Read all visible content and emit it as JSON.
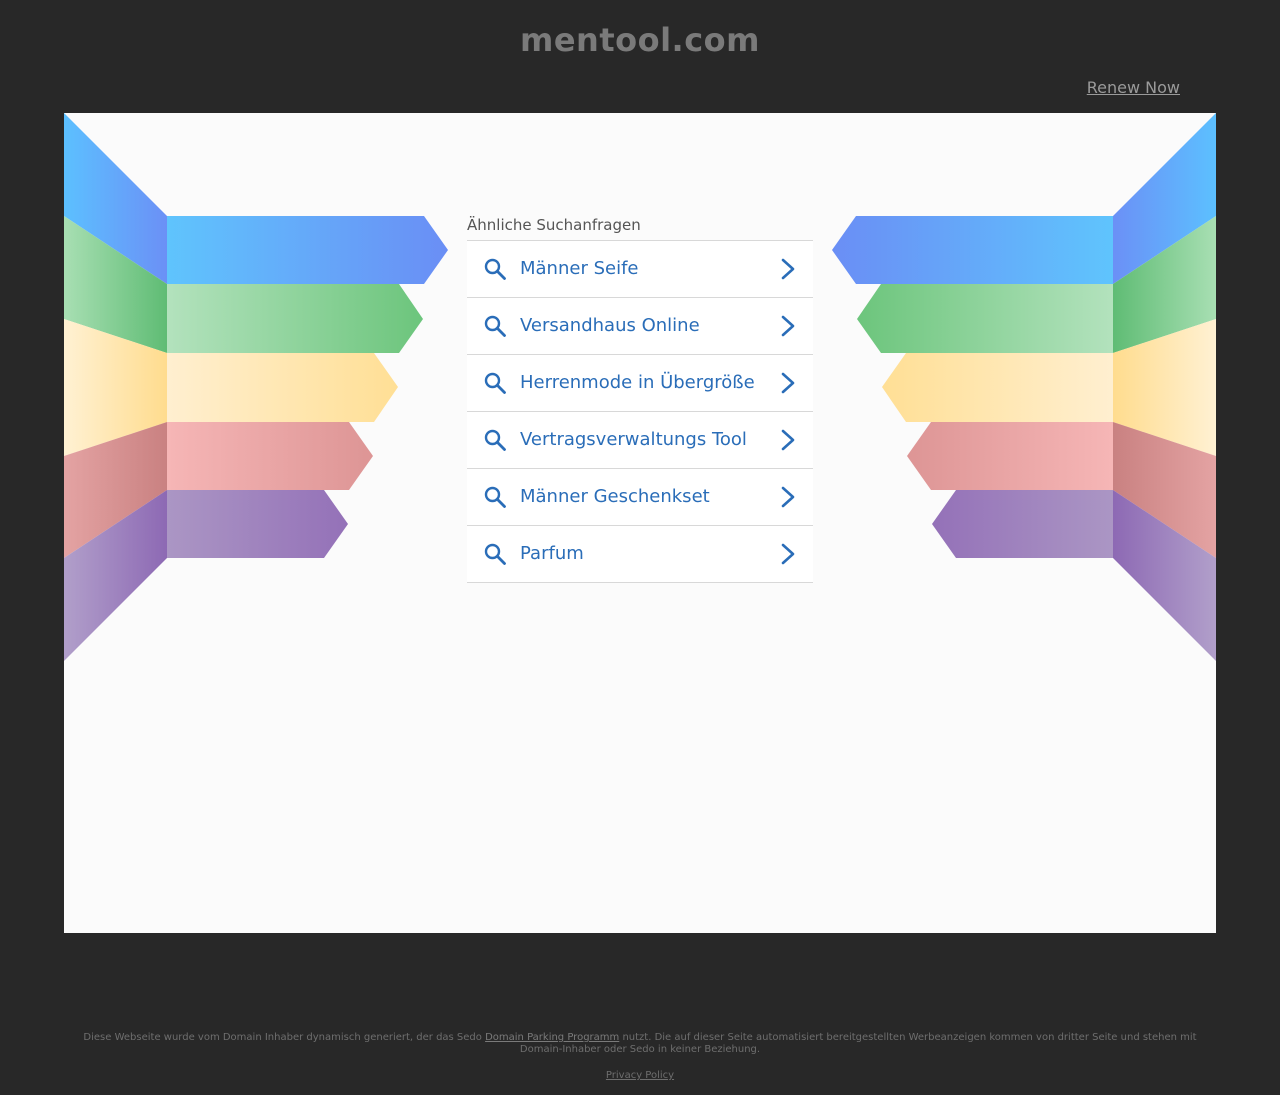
{
  "header": {
    "domain": "mentool.com",
    "renew_label": "Renew Now"
  },
  "search": {
    "heading": "Ähnliche Suchanfragen",
    "items": [
      {
        "label": "Männer Seife"
      },
      {
        "label": "Versandhaus Online"
      },
      {
        "label": "Herrenmode in Übergröße"
      },
      {
        "label": "Vertragsverwaltungs Tool"
      },
      {
        "label": "Männer Geschenkset"
      },
      {
        "label": "Parfum"
      }
    ],
    "item_icon": "search-icon",
    "item_arrow": "chevron-right-icon"
  },
  "footer": {
    "text_before": "Diese Webseite wurde vom Domain Inhaber dynamisch generiert, der das Sedo ",
    "link_label": "Domain Parking Programm",
    "text_after": " nutzt. Die auf dieser Seite automatisiert bereitgestellten Werbeanzeigen kommen von dritter Seite und stehen mit Domain-Inhaber oder Sedo in keiner Beziehung.",
    "privacy_label": "Privacy Policy"
  },
  "colors": {
    "background": "#282828",
    "panel": "#fbfbfb",
    "link_blue": "#2a6db8",
    "ribbon_blue": "#66c2ff",
    "ribbon_green": "#6cc57c",
    "ribbon_yellow": "#ffe3a0",
    "ribbon_red": "#f2a6a6",
    "ribbon_purple": "#9b79c0"
  }
}
